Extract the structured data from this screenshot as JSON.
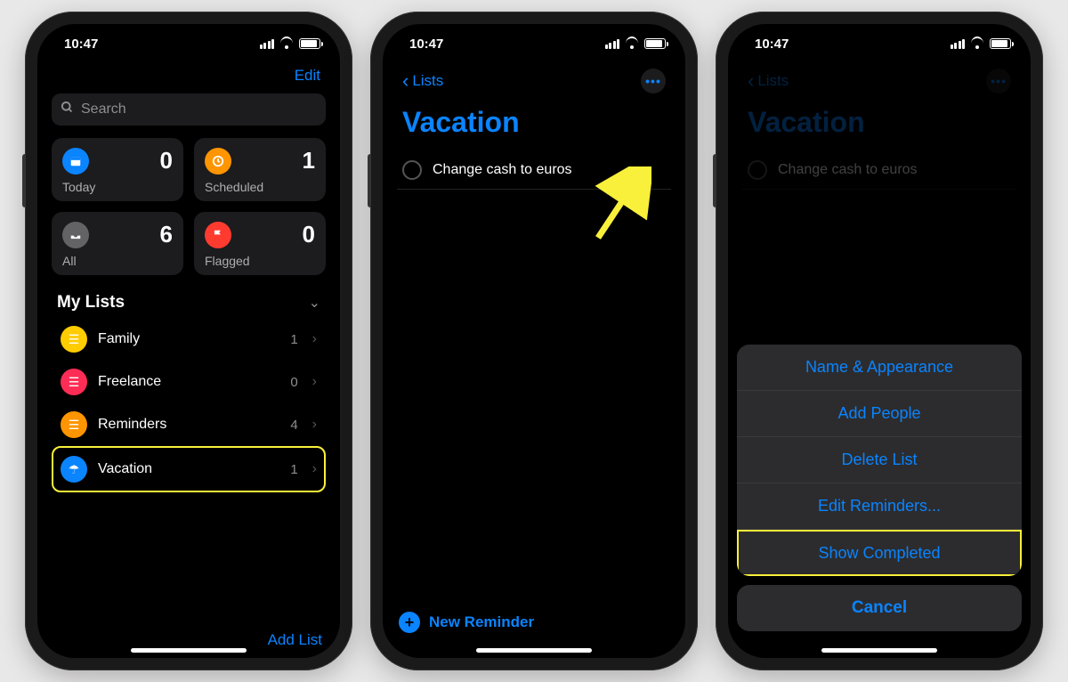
{
  "status": {
    "time": "10:47"
  },
  "phone1": {
    "edit": "Edit",
    "search_placeholder": "Search",
    "cards": {
      "today": {
        "label": "Today",
        "count": "0"
      },
      "scheduled": {
        "label": "Scheduled",
        "count": "1"
      },
      "all": {
        "label": "All",
        "count": "6"
      },
      "flagged": {
        "label": "Flagged",
        "count": "0"
      }
    },
    "section": "My Lists",
    "lists": [
      {
        "name": "Family",
        "count": "1"
      },
      {
        "name": "Freelance",
        "count": "0"
      },
      {
        "name": "Reminders",
        "count": "4"
      },
      {
        "name": "Vacation",
        "count": "1"
      }
    ],
    "add_list": "Add List"
  },
  "phone2": {
    "back": "Lists",
    "title": "Vacation",
    "reminder": "Change cash to euros",
    "new_reminder": "New Reminder"
  },
  "phone3": {
    "back": "Lists",
    "title": "Vacation",
    "reminder": "Change cash to euros",
    "sheet": {
      "name_appearance": "Name & Appearance",
      "add_people": "Add People",
      "delete_list": "Delete List",
      "edit_reminders": "Edit Reminders...",
      "show_completed": "Show Completed",
      "cancel": "Cancel"
    }
  }
}
